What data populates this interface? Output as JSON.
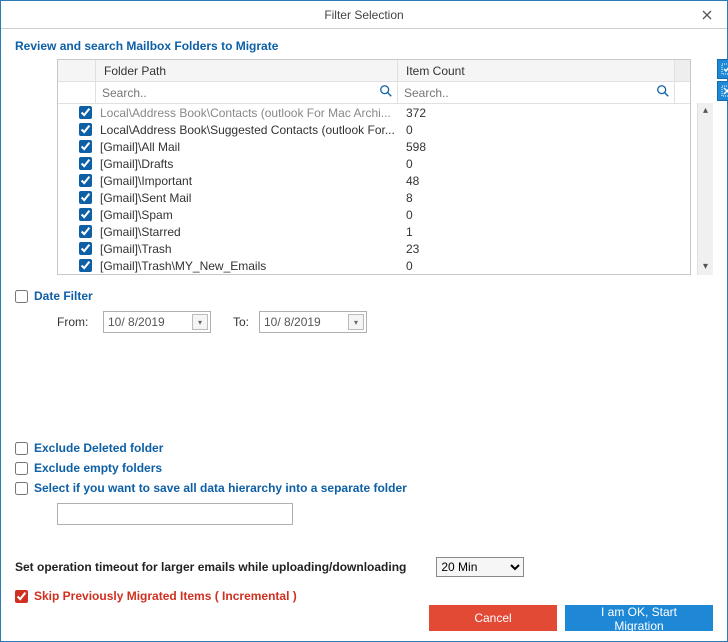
{
  "window": {
    "title": "Filter Selection"
  },
  "subtitle": "Review and search Mailbox Folders to Migrate",
  "grid": {
    "col_folder": "Folder Path",
    "col_count": "Item Count",
    "search_placeholder1": "Search..",
    "search_placeholder2": "Search..",
    "rows": [
      {
        "path": "Local\\Address Book\\Contacts (outlook For Mac Archi...",
        "count": "372",
        "partial": true
      },
      {
        "path": "Local\\Address Book\\Suggested Contacts (outlook For...",
        "count": "0"
      },
      {
        "path": "[Gmail]\\All Mail",
        "count": "598"
      },
      {
        "path": "[Gmail]\\Drafts",
        "count": "0"
      },
      {
        "path": "[Gmail]\\Important",
        "count": "48"
      },
      {
        "path": "[Gmail]\\Sent Mail",
        "count": "8"
      },
      {
        "path": "[Gmail]\\Spam",
        "count": "0"
      },
      {
        "path": "[Gmail]\\Starred",
        "count": "1"
      },
      {
        "path": "[Gmail]\\Trash",
        "count": "23"
      },
      {
        "path": "[Gmail]\\Trash\\MY_New_Emails",
        "count": "0"
      }
    ]
  },
  "date_filter": {
    "label": "Date Filter",
    "from_label": "From:",
    "to_label": "To:",
    "from_value": "10/  8/2019",
    "to_value": "10/  8/2019"
  },
  "options": {
    "exclude_deleted": "Exclude Deleted folder",
    "exclude_empty": "Exclude empty folders",
    "separate_folder": "Select if you want to save all data hierarchy into a separate folder"
  },
  "timeout": {
    "label": "Set operation timeout for larger emails while uploading/downloading",
    "value": "20 Min"
  },
  "skip": {
    "label": "Skip Previously Migrated Items ( Incremental )"
  },
  "buttons": {
    "cancel": "Cancel",
    "start": "I am OK, Start Migration"
  }
}
